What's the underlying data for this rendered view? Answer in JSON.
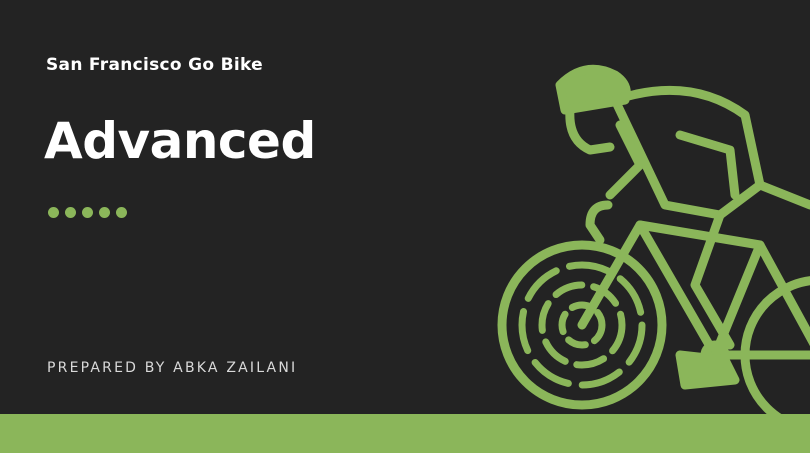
{
  "slide": {
    "subtitle": "San Francisco Go Bike",
    "title": "Advanced",
    "prepared_by": "PREPARED BY ABKA ZAILANI",
    "dot_count": 5
  },
  "colors": {
    "background": "#232323",
    "accent": "#8bb65a",
    "text": "#ffffff"
  },
  "illustration": {
    "icon": "cyclist-icon"
  }
}
